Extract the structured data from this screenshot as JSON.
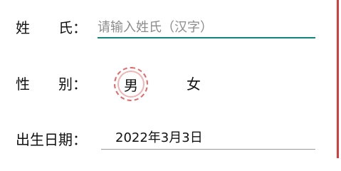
{
  "colors": {
    "accent_underline": "#14857a",
    "selected_gender": "#e26a6a",
    "edge_bar": "#d93a3a"
  },
  "surname": {
    "label": "姓　　氏：",
    "value": "",
    "placeholder": "请输入姓氏（汉字）"
  },
  "gender": {
    "label": "性　　别：",
    "options": [
      {
        "label": "男",
        "selected": true
      },
      {
        "label": "女",
        "selected": false
      }
    ]
  },
  "birth_date": {
    "label": "出生日期：",
    "value": "2022年3月3日"
  }
}
